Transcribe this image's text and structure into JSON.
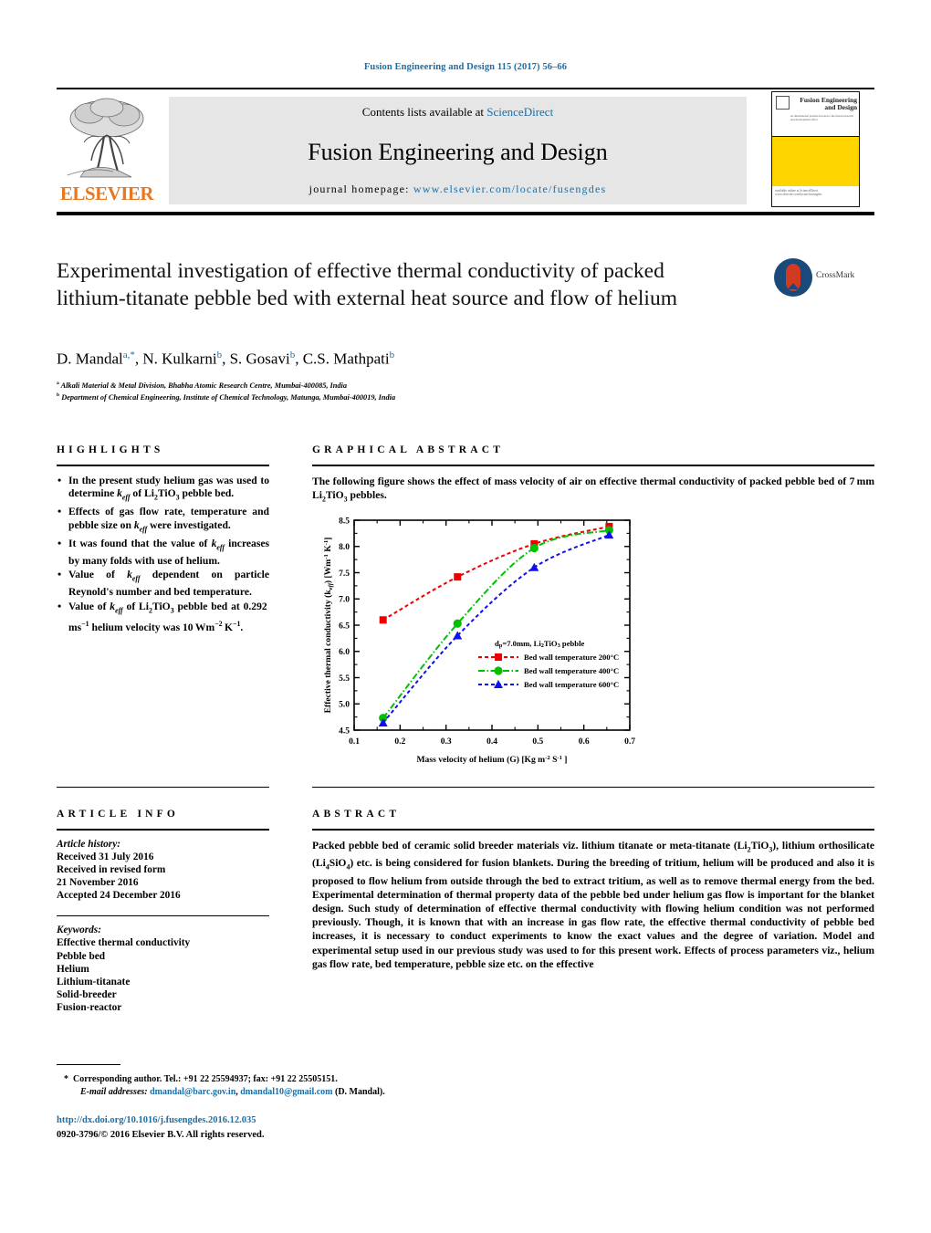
{
  "header": {
    "journal_ref": "Fusion Engineering and Design 115 (2017) 56–66",
    "contents_prefix": "Contents lists available at ",
    "contents_link": "ScienceDirect",
    "journal_title": "Fusion Engineering and Design",
    "homepage_label": "journal homepage:",
    "homepage_url": "www.elsevier.com/locate/fusengdes",
    "publisher": "ELSEVIER",
    "cover_title_line1": "Fusion Engineering",
    "cover_title_line2": "and Design",
    "cover_sub": "an international journal devoted to the fusion research and development effort",
    "cover_footer": "available online at\nScienceDirect\nwww.elsevier.com/locate/fusengdes"
  },
  "article": {
    "title": "Experimental investigation of effective thermal conductivity of packed lithium-titanate pebble bed with external heat source and flow of helium",
    "authors_html": "D. Mandal<sup>a,*</sup>, N. Kulkarni<sup>b</sup>, S. Gosavi<sup>b</sup>, C.S. Mathpati<sup>b</sup>",
    "affiliation_a": "Alkali Material & Metal Division, Bhabha Atomic Research Centre, Mumbai-400085, India",
    "affiliation_b": "Department of Chemical Engineering, Institute of Chemical Technology, Matunga, Mumbai-400019, India",
    "crossmark_label": "CrossMark"
  },
  "highlights": {
    "heading": "HIGHLIGHTS",
    "items_html": [
      "In the present study helium gas was used to determine <i>k<sub>eff</sub></i> of Li<sub>2</sub>TiO<sub>3</sub> pebble bed.",
      "Effects of gas flow rate, temperature and pebble size on <i>k<sub>eff</sub></i> were investigated.",
      "It was found that the value of <i>k<sub>eff</sub></i> increases by many folds with use of helium.",
      "Value of <i>k<sub>eff</sub></i> dependent on particle Reynold's number and bed temperature.",
      "Value of <i>k<sub>eff</sub></i> of Li<sub>2</sub>TiO<sub>3</sub> pebble bed at 0.292 ms<sup>−1</sup> helium velocity was 10 Wm<sup>−2</sup> K<sup>−1</sup>."
    ]
  },
  "graphical_abstract": {
    "heading": "GRAPHICAL ABSTRACT",
    "caption_html": "The following figure shows the effect of mass velocity of air on effective thermal conductivity of packed pebble bed of 7 mm Li<sub>2</sub>TiO<sub>3</sub> pebbles."
  },
  "chart_data": {
    "type": "scatter",
    "title": "",
    "xlabel_html": "Mass velocity of helium (G)   [Kg m<sup>-2</sup> S<sup>-1</sup> ]",
    "ylabel_html": "Effective thermal conductivity (k<sub>eff</sub>)  [Wm<sup>-1</sup> K<sup>-1</sup>]",
    "xlim": [
      0.1,
      0.7
    ],
    "ylim": [
      4.5,
      8.5
    ],
    "xticks": [
      0.1,
      0.2,
      0.3,
      0.4,
      0.5,
      0.6,
      0.7
    ],
    "xticklabels": [
      "0.1",
      "0.2",
      "0.3",
      "0.4",
      "0.5",
      "0.6",
      "0.7"
    ],
    "yticks": [
      4.5,
      5.0,
      5.5,
      6.0,
      6.5,
      7.0,
      7.5,
      8.0,
      8.5
    ],
    "yticklabels": [
      "4.5",
      "5.0",
      "5.5",
      "6.0",
      "6.5",
      "7.0",
      "7.5",
      "8.0",
      "8.5"
    ],
    "grid": false,
    "legend_position": "lower-right",
    "legend_note_html": "d<sub>p</sub>=7.0mm, Li<sub>2</sub>TiO<sub>3</sub> pebble",
    "series": [
      {
        "name": "Bed wall temperature 200°C",
        "color": "#ee0000",
        "marker": "square",
        "linestyle": "dashed",
        "x": [
          0.163,
          0.325,
          0.492,
          0.655
        ],
        "y": [
          6.6,
          7.42,
          8.05,
          8.38
        ]
      },
      {
        "name": "Bed wall temperature 400°C",
        "color": "#00c000",
        "marker": "circle",
        "linestyle": "dash-dot",
        "x": [
          0.163,
          0.325,
          0.492,
          0.655
        ],
        "y": [
          4.73,
          6.53,
          7.97,
          8.31
        ]
      },
      {
        "name": "Bed wall temperature 600°C",
        "color": "#1010ee",
        "marker": "triangle",
        "linestyle": "dashed",
        "x": [
          0.163,
          0.325,
          0.492,
          0.655
        ],
        "y": [
          4.64,
          6.3,
          7.6,
          8.22
        ]
      }
    ]
  },
  "article_info": {
    "heading": "ARTICLE INFO",
    "history_label": "Article history:",
    "history_lines": [
      "Received 31 July 2016",
      "Received in revised form",
      "21 November 2016",
      "Accepted 24 December 2016"
    ],
    "keywords_label": "Keywords:",
    "keywords": [
      "Effective thermal conductivity",
      "Pebble bed",
      "Helium",
      "Lithium-titanate",
      "Solid-breeder",
      "Fusion-reactor"
    ]
  },
  "abstract": {
    "heading": "ABSTRACT",
    "body_html": "Packed pebble bed of ceramic solid breeder materials viz. lithium titanate or meta-titanate (Li<sub>2</sub>TiO<sub>3</sub>), lithium orthosilicate (Li<sub>4</sub>SiO<sub>4</sub>) etc. is being considered for fusion blankets. During the breeding of tritium, helium will be produced and also it is proposed to flow helium from outside through the bed to extract tritium, as well as to remove thermal energy from the bed. Experimental determination of thermal property data of the pebble bed under helium gas flow is important for the blanket design. Such study of determination of effective thermal conductivity with flowing helium condition was not performed previously. Though, it is known that with an increase in gas flow rate, the effective thermal conductivity of pebble bed increases, it is necessary to conduct experiments to know the exact values and the degree of variation. Model and experimental setup used in our previous study was used to for this present work. Effects of process parameters viz., helium gas flow rate, bed temperature, pebble size etc. on the effective"
  },
  "footer": {
    "corresponding_html": "* &nbsp;Corresponding author. Tel.: +91 22 25594937; fax: +91 22 25505151.",
    "email_label": "E-mail addresses:",
    "email1": "dmandal@barc.gov.in",
    "email2": "dmandal10@gmail.com",
    "email_suffix": "(D. Mandal).",
    "doi": "http://dx.doi.org/10.1016/j.fusengdes.2016.12.035",
    "copyright": "0920-3796/© 2016 Elsevier B.V. All rights reserved."
  },
  "colors": {
    "link": "#1a6fa8",
    "elsevier_orange": "#E87722",
    "cover_yellow": "#FFD500"
  }
}
